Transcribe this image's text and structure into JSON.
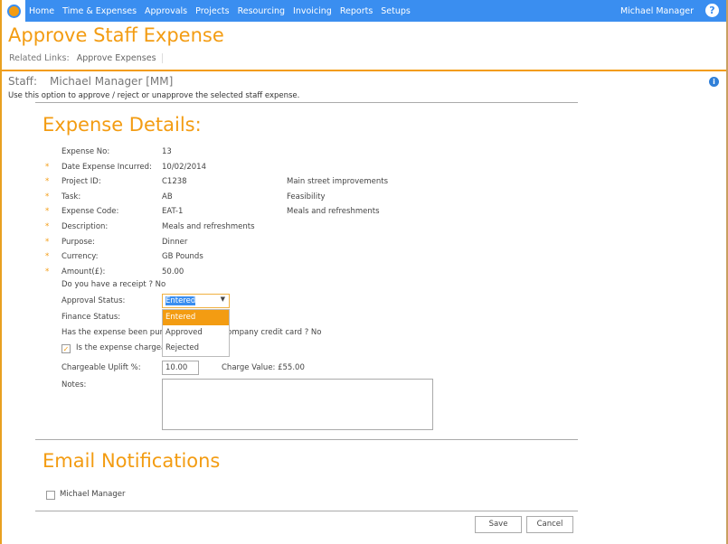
{
  "nav": {
    "items": [
      "Home",
      "Time & Expenses",
      "Approvals",
      "Projects",
      "Resourcing",
      "Invoicing",
      "Reports",
      "Setups"
    ],
    "user": "Michael Manager",
    "help": "?"
  },
  "page": {
    "title": "Approve Staff Expense",
    "related_label": "Related Links:",
    "related_link": "Approve Expenses",
    "staff_label": "Staff:",
    "staff_name": "Michael Manager [MM]",
    "description": "Use this option to approve / reject or unapprove the selected staff expense.",
    "info": "i"
  },
  "details": {
    "heading": "Expense Details:",
    "fields": [
      {
        "label": "Expense No:",
        "value": "13",
        "extra": "",
        "required": false
      },
      {
        "label": "Date Expense Incurred:",
        "value": "10/02/2014",
        "extra": "",
        "required": true
      },
      {
        "label": "Project ID:",
        "value": "C1238",
        "extra": "Main street improvements",
        "required": true
      },
      {
        "label": "Task:",
        "value": "AB",
        "extra": "Feasibility",
        "required": true
      },
      {
        "label": "Expense Code:",
        "value": "EAT-1",
        "extra": "Meals and refreshments",
        "required": true
      },
      {
        "label": "Description:",
        "value": "Meals and refreshments",
        "extra": "",
        "required": true
      },
      {
        "label": "Purpose:",
        "value": "Dinner",
        "extra": "",
        "required": true
      },
      {
        "label": "Currency:",
        "value": "GB Pounds",
        "extra": "",
        "required": true
      },
      {
        "label": "Amount(£):",
        "value": "50.00",
        "extra": "",
        "required": true
      }
    ],
    "receipt": "Do you have a receipt ?  No",
    "approval_label": "Approval Status:",
    "approval_value": "Entered",
    "approval_options": [
      "Entered",
      "Approved",
      "Rejected"
    ],
    "finance_label": "Finance Status:",
    "credit_card": "Has the expense been purchased using a company credit card ? No",
    "chargeable_label": "Is the expense chargeable?",
    "chargeable_checked": true,
    "uplift_label": "Chargeable Uplift %:",
    "uplift_value": "10.00",
    "charge_value": "Charge Value: £55.00",
    "notes_label": "Notes:",
    "notes_value": ""
  },
  "email": {
    "heading": "Email Notifications",
    "recipient": "Michael Manager",
    "checked": false
  },
  "buttons": {
    "save": "Save",
    "cancel": "Cancel"
  }
}
